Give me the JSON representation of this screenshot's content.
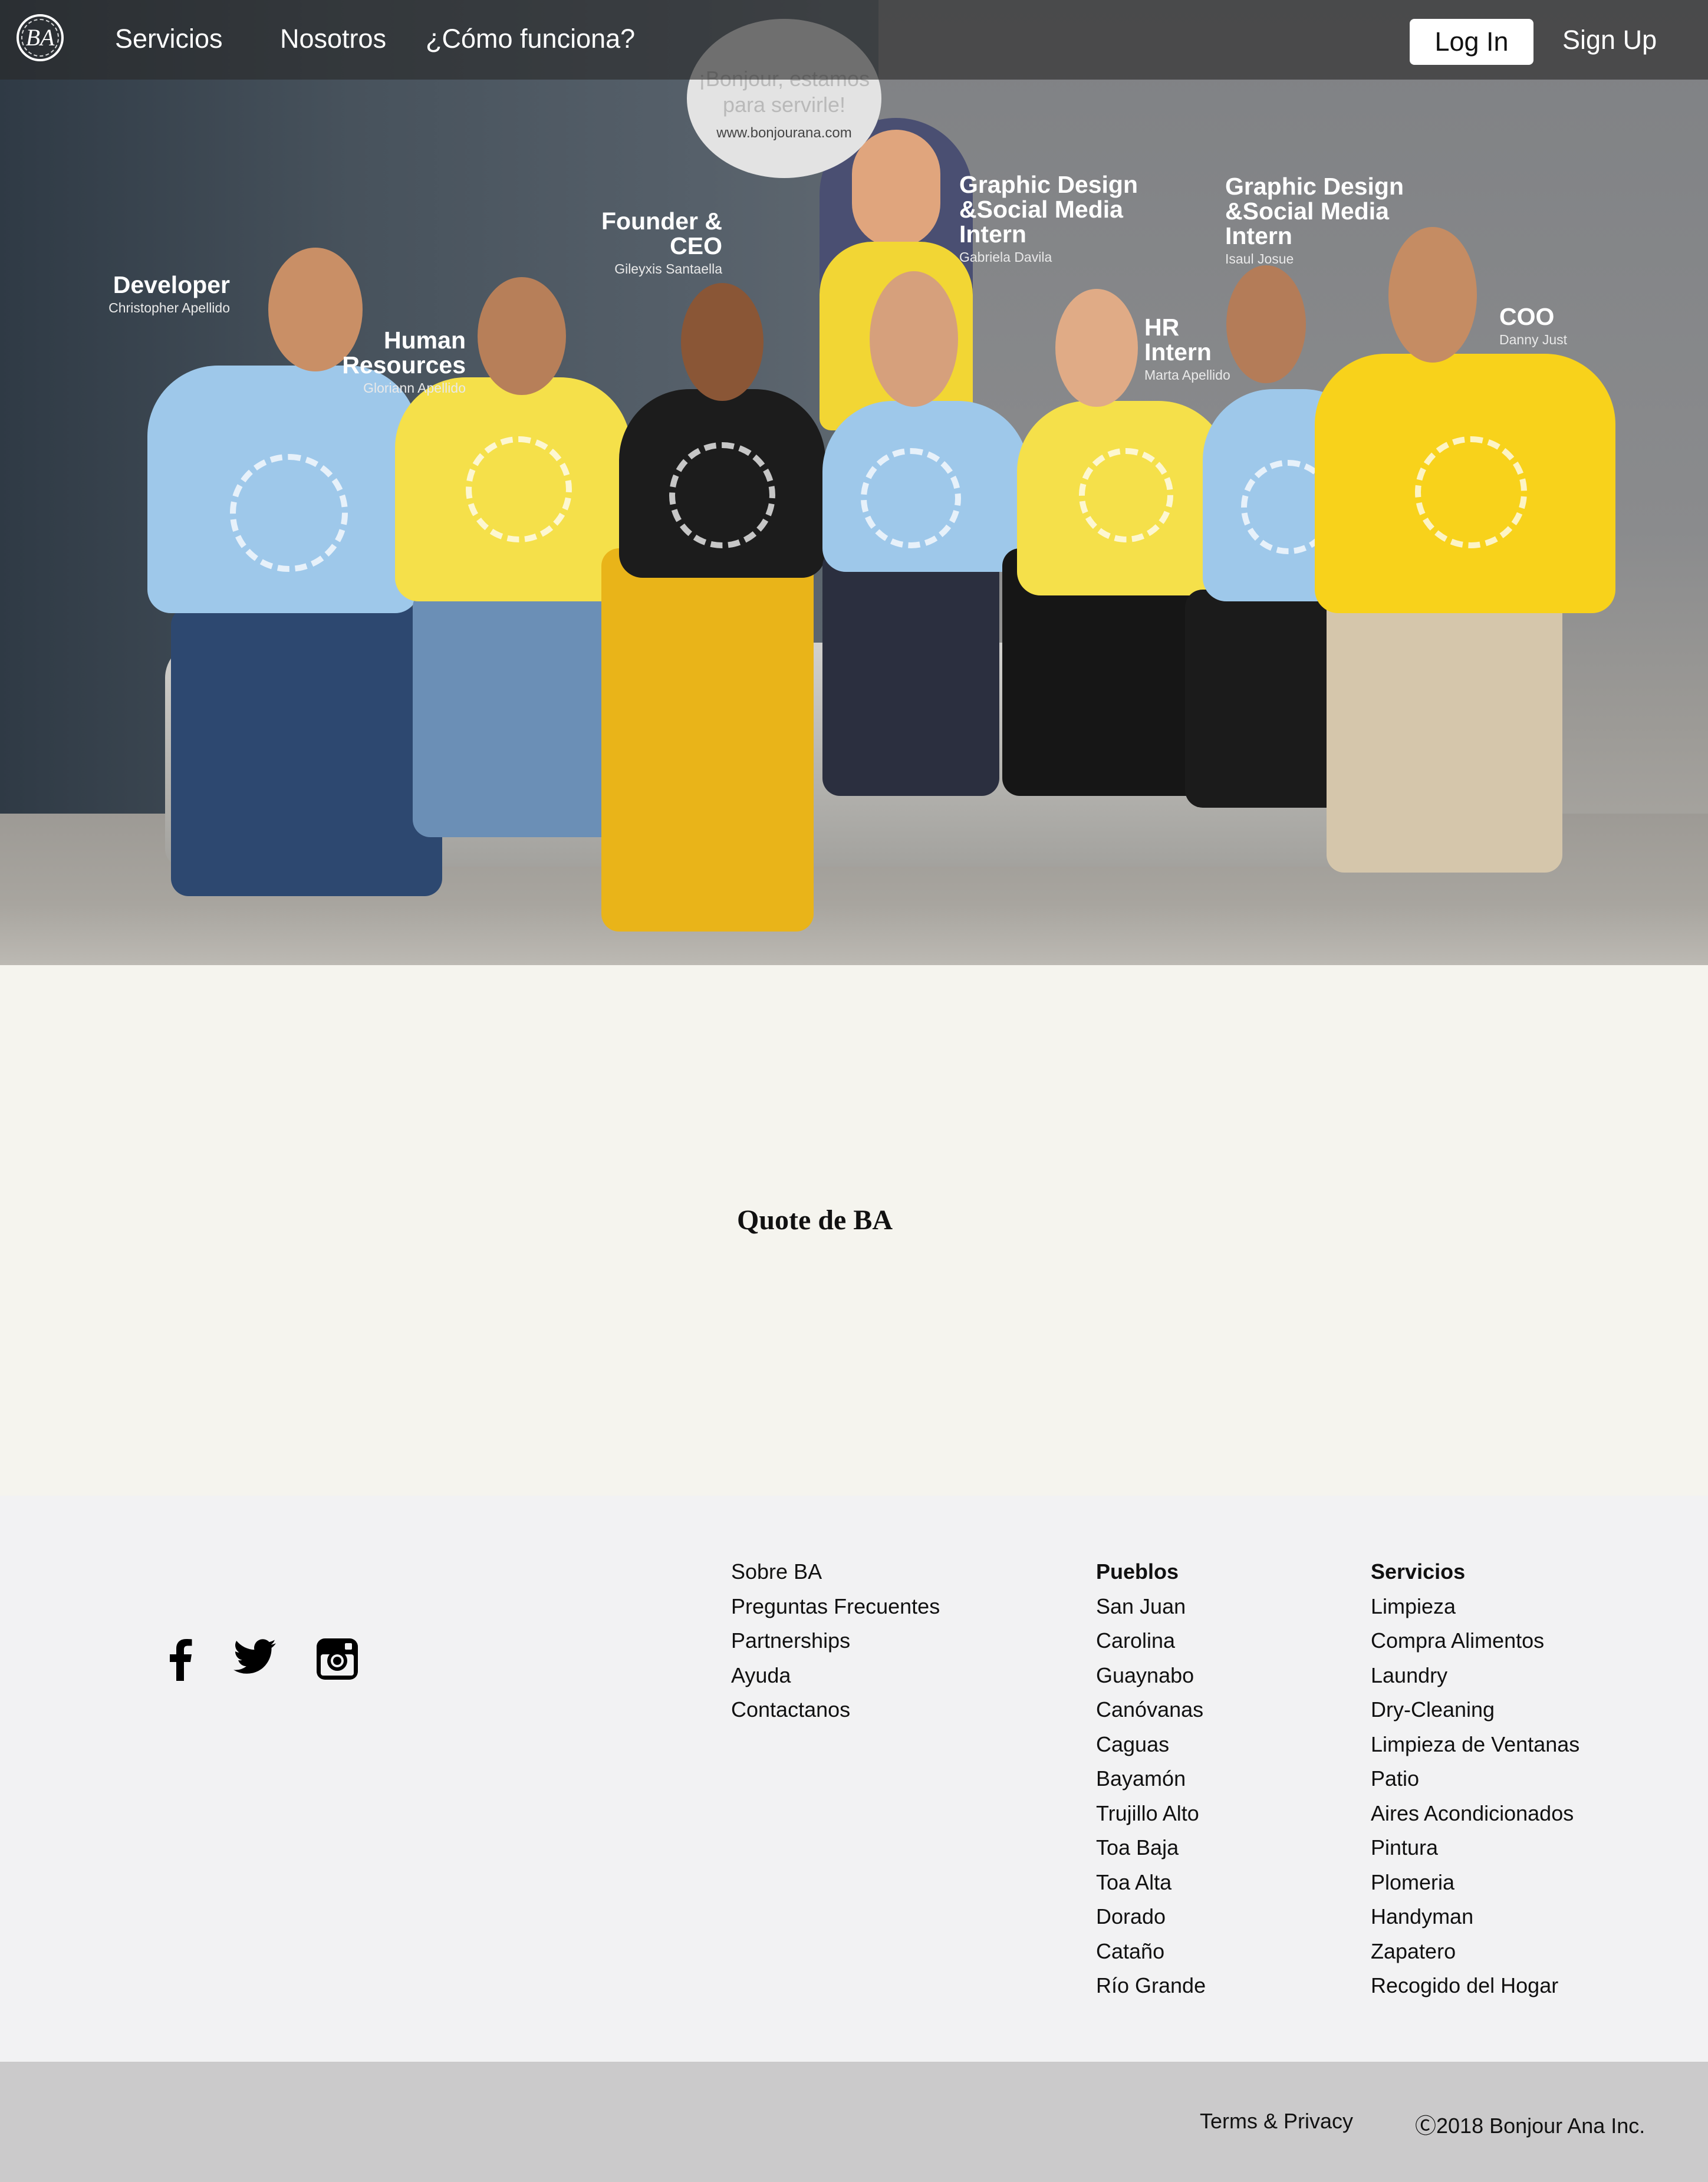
{
  "nav": {
    "brand": "BA",
    "links": [
      "Servicios",
      "Nosotros",
      "¿Cómo funciona?"
    ],
    "login": "Log In",
    "signup": "Sign Up"
  },
  "hero": {
    "bubble_text": "¡Bonjour, estamos para servirle!",
    "bubble_url": "www.bonjourana.com",
    "team": [
      {
        "role": "Developer",
        "name": "Christopher Apellido"
      },
      {
        "role": "Human Resources",
        "name": "Gloriann Apellido"
      },
      {
        "role": "Founder & CEO",
        "name": "Gileyxis Santaella"
      },
      {
        "role": "Graphic Design &Social Media Intern",
        "name": "Gabriela Davila"
      },
      {
        "role": "HR Intern",
        "name": "Marta Apellido"
      },
      {
        "role": "Graphic Design &Social Media Intern",
        "name": "Isaul Josue"
      },
      {
        "role": "COO",
        "name": "Danny Just"
      }
    ]
  },
  "quote": {
    "text": "Quote de BA"
  },
  "footer": {
    "social": [
      "facebook-icon",
      "twitter-icon",
      "instagram-icon"
    ],
    "about": [
      "Sobre BA",
      "Preguntas Frecuentes",
      "Partnerships",
      "Ayuda",
      "Contactanos"
    ],
    "pueblos": {
      "heading": "Pueblos",
      "items": [
        "San Juan",
        "Carolina",
        "Guaynabo",
        "Canóvanas",
        "Caguas",
        "Bayamón",
        "Trujillo Alto",
        "Toa Baja",
        "Toa Alta",
        "Dorado",
        "Cataño",
        "Río Grande"
      ]
    },
    "servicios": {
      "heading": "Servicios",
      "items": [
        "Limpieza",
        "Compra Alimentos",
        "Laundry",
        "Dry-Cleaning",
        "Limpieza de Ventanas",
        "Patio",
        "Aires Acondicionados",
        "Pintura",
        "Plomeria",
        "Handyman",
        "Zapatero",
        "Recogido del Hogar"
      ]
    },
    "terms": "Terms & Privacy",
    "copyright": "Ⓒ2018 Bonjour Ana Inc."
  },
  "colors": {
    "nav_overlay": "#282828",
    "quote_bg": "#f5f4ee",
    "footer_bg": "#f2f2f3",
    "bottom_bar": "#cbcacb",
    "shirt_blue": "#9ec8ea",
    "shirt_yellow": "#f5e04a",
    "shirt_black": "#1c1c1c"
  }
}
